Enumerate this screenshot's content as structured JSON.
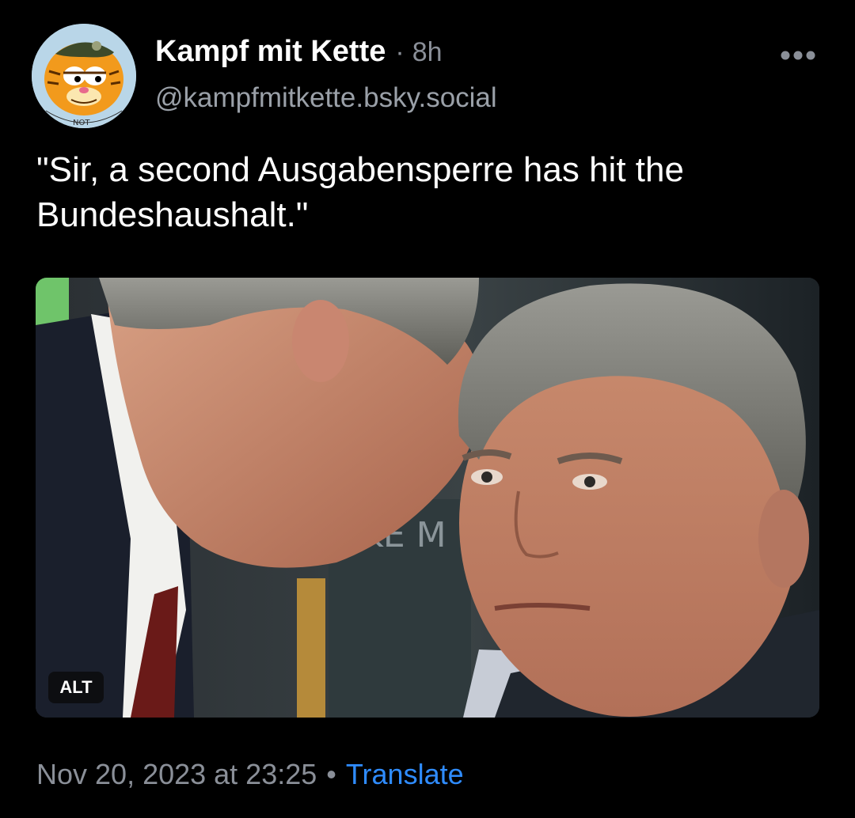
{
  "author": {
    "display_name": "Kampf mit Kette",
    "time_separator": "·",
    "time_ago": "8h",
    "handle": "@kampfmitkette.bsky.social",
    "avatar_caption": "NOT"
  },
  "post": {
    "text": "\"Sir, a second Ausgabensperre has hit the Bundeshaushalt.\"",
    "image_sign_text": "KE\nM"
  },
  "media": {
    "alt_label": "ALT"
  },
  "meta": {
    "timestamp": "Nov 20, 2023 at 23:25",
    "separator": "•",
    "translate_label": "Translate"
  },
  "icons": {
    "more": "more-horizontal-icon"
  },
  "colors": {
    "background": "#000000",
    "secondary_text": "#8a8f98",
    "link": "#2f8cff",
    "avatar_orange": "#f29a1c"
  }
}
